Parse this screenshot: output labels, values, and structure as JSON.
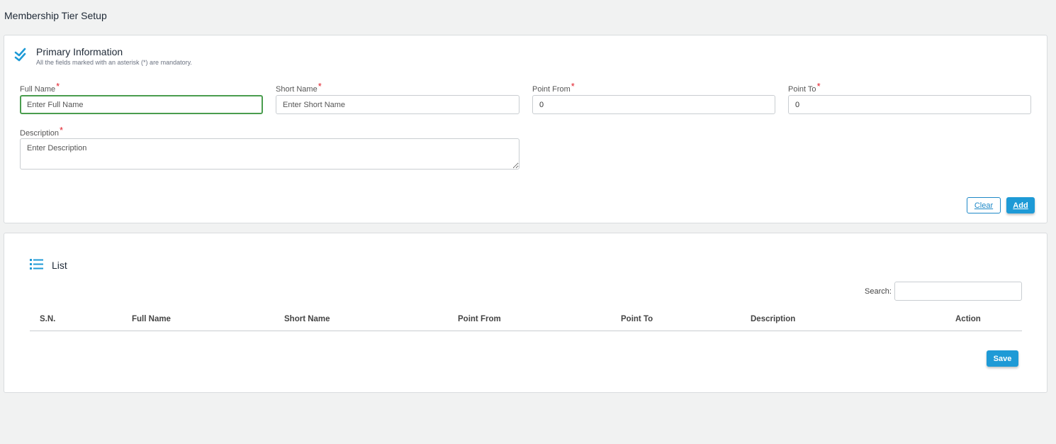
{
  "page": {
    "title": "Membership Tier Setup"
  },
  "primary": {
    "icon": "double-check-icon",
    "title": "Primary Information",
    "subtitle": "All the fields marked with an asterisk (*) are mandatory.",
    "required_mark": "*",
    "fields": {
      "full_name": {
        "label": "Full Name",
        "placeholder": "Enter Full Name",
        "value": ""
      },
      "short_name": {
        "label": "Short Name",
        "placeholder": "Enter Short Name",
        "value": ""
      },
      "point_from": {
        "label": "Point From",
        "placeholder": "",
        "value": "0"
      },
      "point_to": {
        "label": "Point To",
        "placeholder": "",
        "value": "0"
      },
      "description": {
        "label": "Description",
        "placeholder": "Enter Description",
        "value": ""
      }
    },
    "buttons": {
      "clear": "Clear",
      "add": "Add"
    }
  },
  "list": {
    "icon": "list-icon",
    "title": "List",
    "search": {
      "label": "Search:",
      "value": ""
    },
    "columns": [
      "S.N.",
      "Full Name",
      "Short Name",
      "Point From",
      "Point To",
      "Description",
      "Action"
    ],
    "rows": [],
    "save_label": "Save"
  },
  "colors": {
    "accent": "#1e9ad6",
    "focus": "#4a9d4e",
    "required": "#e11d28",
    "background": "#f1f2f2"
  }
}
